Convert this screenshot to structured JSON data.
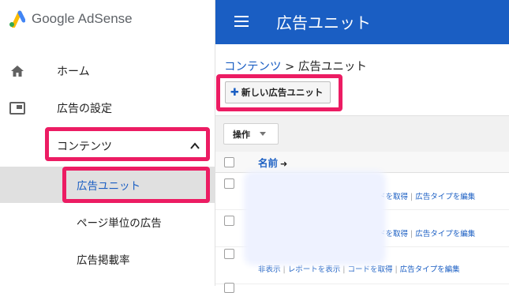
{
  "app": {
    "logo_text": "Google AdSense",
    "brand_color": "#1a5ec3",
    "highlight_color": "#ec1c63"
  },
  "sidebar": {
    "items": [
      {
        "label": "ホーム",
        "icon": "home-icon"
      },
      {
        "label": "広告の設定",
        "icon": "ad-settings-icon"
      },
      {
        "label": "コンテンツ",
        "icon": "chevron-up-icon",
        "expanded": true
      },
      {
        "label": "広告ユニット",
        "active": true
      },
      {
        "label": "ページ単位の広告"
      },
      {
        "label": "広告掲載率"
      }
    ]
  },
  "header": {
    "title": "広告ユニット",
    "menu_icon": "hamburger-menu-icon"
  },
  "main": {
    "breadcrumb": {
      "link": "コンテンツ",
      "separator": ">",
      "current": "広告ユニット"
    },
    "new_button": {
      "icon": "plus-icon",
      "label": "新しい広告ユニット"
    },
    "toolbar": {
      "operations_label": "操作"
    },
    "table": {
      "name_header": "名前",
      "sort_icon": "sort-ascending-icon",
      "rows": [
        {
          "actions": [
            "ドを取得",
            "広告タイプを編集"
          ]
        },
        {
          "actions": [
            "ドを取得",
            "広告タイプを編集"
          ]
        },
        {
          "actions": [
            "非表示",
            "レポートを表示",
            "コードを取得",
            "広告タイプを編集"
          ]
        }
      ]
    }
  }
}
